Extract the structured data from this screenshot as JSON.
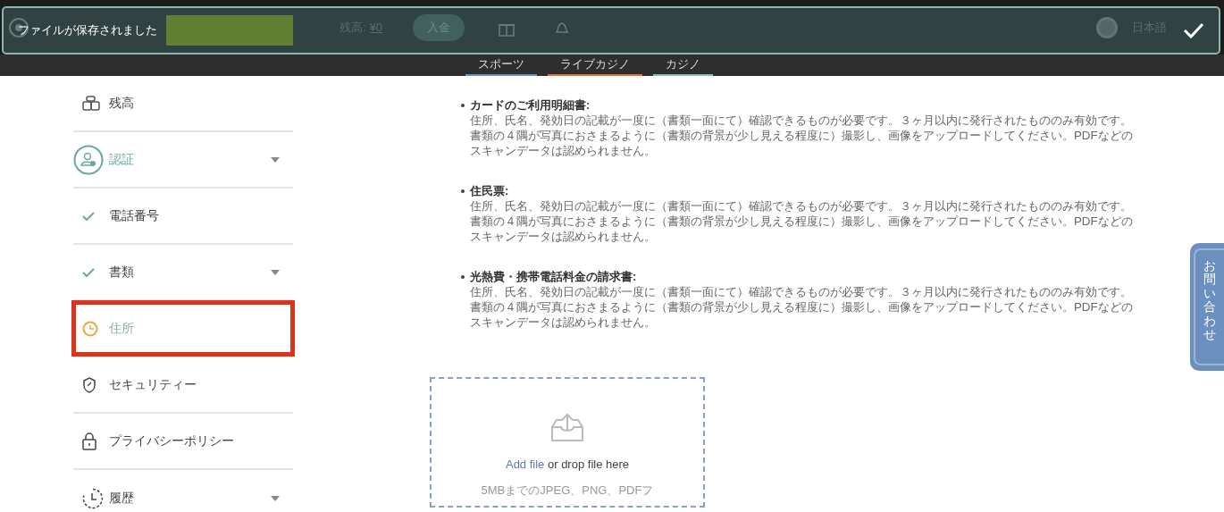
{
  "header": {
    "balance_label": "残高:",
    "balance_value": "¥0",
    "deposit_button": "入金",
    "language": "日本語"
  },
  "toast": {
    "message": "ファイルが保存されました"
  },
  "nav_tabs": [
    {
      "label": "スポーツ",
      "color": "#6a8fc4"
    },
    {
      "label": "ライブカジノ",
      "color": "#e0703c"
    },
    {
      "label": "カジノ",
      "color": "#7cc0b8"
    }
  ],
  "sidebar": {
    "items": [
      {
        "kind": "coins",
        "label": "残高",
        "selected": false,
        "caret": false,
        "highlighted": false
      },
      {
        "kind": "user",
        "label": "認証",
        "selected": true,
        "caret": true,
        "highlighted": false
      },
      {
        "kind": "check",
        "label": "電話番号",
        "selected": false,
        "caret": false,
        "highlighted": false
      },
      {
        "kind": "check",
        "label": "書類",
        "selected": false,
        "caret": true,
        "highlighted": false
      },
      {
        "kind": "pending",
        "label": "住所",
        "selected": false,
        "caret": false,
        "highlighted": true
      },
      {
        "kind": "shield",
        "label": "セキュリティー",
        "selected": false,
        "caret": false,
        "highlighted": false
      },
      {
        "kind": "lock",
        "label": "プライバシーポリシー",
        "selected": false,
        "caret": false,
        "highlighted": false
      },
      {
        "kind": "history",
        "label": "履歴",
        "selected": false,
        "caret": true,
        "highlighted": false
      }
    ]
  },
  "documents": [
    {
      "title": "カードのご利用明細書:",
      "text": "住所、氏名、発効日の記載が一度に（書類一面にて）確認できるものが必要です。３ヶ月以内に発行されたもののみ有効です。書類の４隅が写真におさまるように（書類の背景が少し見える程度に）撮影し、画像をアップロードしてください。PDFなどのスキャンデータは認められません。"
    },
    {
      "title": "住民票:",
      "text": "住所、氏名、発効日の記載が一度に（書類一面にて）確認できるものが必要です。３ヶ月以内に発行されたもののみ有効です。書類の４隅が写真におさまるように（書類の背景が少し見える程度に）撮影し、画像をアップロードしてください。PDFなどのスキャンデータは認められません。"
    },
    {
      "title": "光熱費・携帯電話料金の請求書:",
      "text": "住所、氏名、発効日の記載が一度に（書類一面にて）確認できるものが必要です。３ヶ月以内に発行されたもののみ有効です。書類の４隅が写真におさまるように（書類の背景が少し見える程度に）撮影し、画像をアップロードしてください。PDFなどのスキャンデータは認められません。"
    }
  ],
  "upload": {
    "link": "Add file",
    "text": "or drop file here",
    "hint": "5MBまでのJPEG、PNG、PDFフ"
  },
  "contact_tab": {
    "label": "お問い合わせ"
  }
}
